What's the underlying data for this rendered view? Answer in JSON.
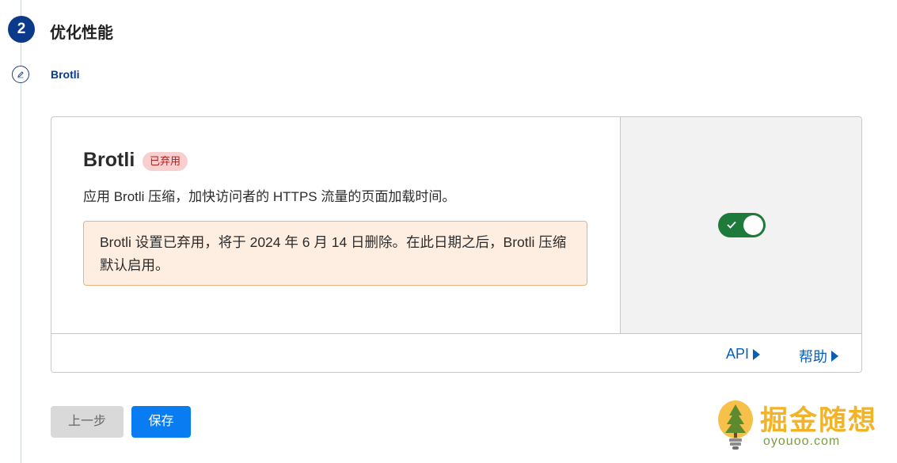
{
  "step": {
    "number": "2",
    "title": "优化性能"
  },
  "substep": {
    "title": "Brotli",
    "icon": "pencil-icon"
  },
  "card": {
    "title": "Brotli",
    "badge": "已弃用",
    "description": "应用 Brotli 压缩，加快访问者的 HTTPS 流量的页面加载时间。",
    "warning": "Brotli 设置已弃用，将于 2024 年 6 月 14 日删除。在此日期之后，Brotli 压缩默认启用。",
    "toggle": {
      "on": true,
      "color": "#1e7a3b"
    },
    "links": {
      "api": "API",
      "help": "帮助"
    }
  },
  "buttons": {
    "back": "上一步",
    "save": "保存"
  },
  "watermark": {
    "title": "掘金随想",
    "url": "oyouoo.com"
  },
  "colors": {
    "accent": "#0b3a8a",
    "primary_button": "#0a7cf2",
    "link": "#0b5fb3"
  }
}
